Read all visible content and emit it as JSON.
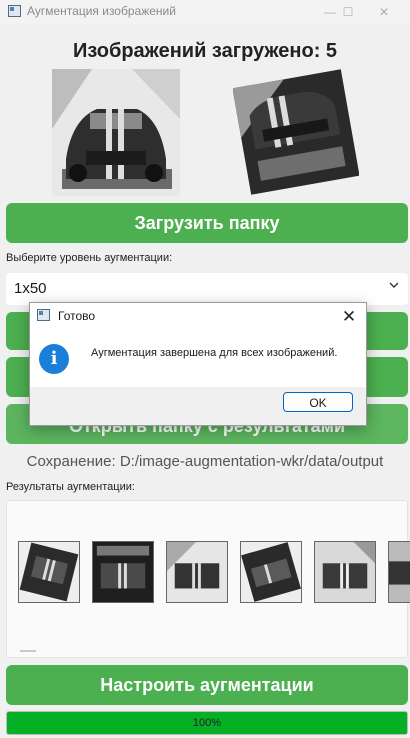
{
  "window": {
    "title": "Аугментация изображений",
    "minimize_glyph": "—",
    "maximize_glyph": "☐",
    "close_glyph": "✕"
  },
  "header": {
    "loaded_text": "Изображений загружено: 5"
  },
  "buttons": {
    "load_folder": "Загрузить папку",
    "hidden_button_1": "",
    "hidden_button_2": "",
    "open_results": "Открыть папку с результатами",
    "configure": "Настроить аугментации"
  },
  "augmentation": {
    "level_label": "Выберите уровень аугментации:",
    "level_value": "1x50",
    "chevron": "⌄"
  },
  "save_path": "Сохранение: D:/image-augmentation-wkr/data/output",
  "results": {
    "label": "Результаты аугментации:"
  },
  "progress": {
    "value_percent": 100,
    "text": "100%"
  },
  "dialog": {
    "title": "Готово",
    "close_glyph": "✕",
    "info_glyph": "i",
    "message": "Аугментация завершена для всех изображений.",
    "ok_label": "OK"
  },
  "colors": {
    "accent_green": "#4caf50",
    "progress_green": "#06b025",
    "info_blue": "#1a7fd8",
    "ok_border": "#0067c0"
  },
  "icons": [
    "app-window-icon",
    "info-icon",
    "close-icon",
    "chevron-down-icon"
  ]
}
